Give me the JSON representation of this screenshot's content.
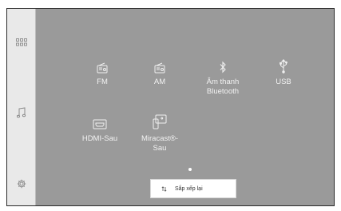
{
  "sidebar": {
    "items": [
      {
        "name": "apps",
        "icon": "grid-icon"
      },
      {
        "name": "music",
        "icon": "music-note-icon"
      },
      {
        "name": "settings",
        "icon": "gear-icon"
      }
    ]
  },
  "sources": [
    {
      "label": "FM",
      "icon": "radio-icon"
    },
    {
      "label": "AM",
      "icon": "radio-icon"
    },
    {
      "label": "Âm thanh\nBluetooth",
      "icon": "bluetooth-icon"
    },
    {
      "label": "USB",
      "icon": "usb-icon"
    },
    {
      "label": "HDMI-Sau",
      "icon": "hdmi-icon"
    },
    {
      "label": "Miracast®-\nSau",
      "icon": "miracast-icon"
    }
  ],
  "pagination": {
    "current": 1,
    "total": 1
  },
  "rearrange_button": {
    "label": "Sắp xếp lại",
    "icon": "rearrange-icon"
  },
  "colors": {
    "panel": "#9a9a9a",
    "sidebar": "#e9e9e9",
    "text": "#f2f2f2"
  }
}
